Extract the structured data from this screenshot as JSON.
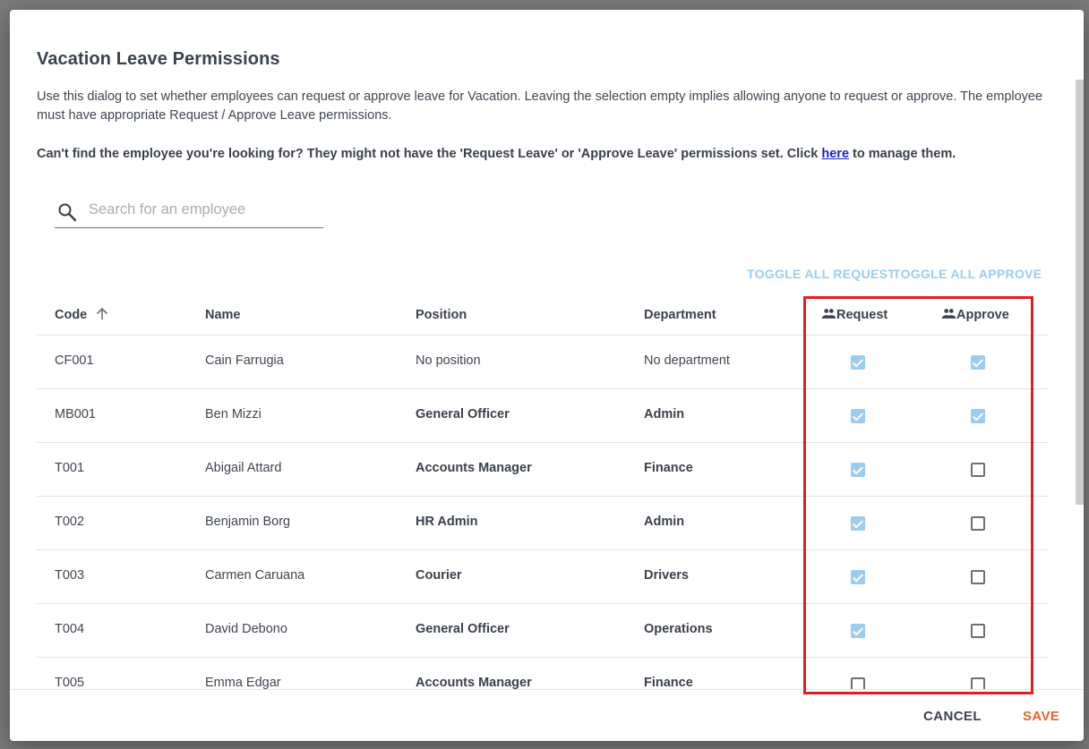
{
  "dialog": {
    "title": "Vacation Leave Permissions",
    "description": "Use this dialog to set whether employees can request or approve leave for Vacation. Leaving the selection empty implies allowing anyone to request or approve. The employee must have appropriate Request / Approve Leave permissions.",
    "note_before": "Can't find the employee you're looking for? They might not have the 'Request Leave' or 'Approve Leave' permissions set. Click ",
    "note_link": "here",
    "note_after": " to manage them."
  },
  "search": {
    "placeholder": "Search for an employee",
    "value": ""
  },
  "actions": {
    "toggle_request": "TOGGLE ALL REQUEST",
    "toggle_approve": "TOGGLE ALL APPROVE"
  },
  "table": {
    "headers": {
      "code": "Code",
      "name": "Name",
      "position": "Position",
      "department": "Department",
      "request": "Request",
      "approve": "Approve"
    },
    "sort": {
      "column": "code",
      "direction": "ascending"
    },
    "rows": [
      {
        "code": "CF001",
        "name": "Cain Farrugia",
        "position": "No position",
        "department": "No department",
        "request": true,
        "approve": true
      },
      {
        "code": "MB001",
        "name": "Ben Mizzi",
        "position": "General Officer",
        "department": "Admin",
        "request": true,
        "approve": true
      },
      {
        "code": "T001",
        "name": "Abigail Attard",
        "position": "Accounts Manager",
        "department": "Finance",
        "request": true,
        "approve": false
      },
      {
        "code": "T002",
        "name": "Benjamin Borg",
        "position": "HR Admin",
        "department": "Admin",
        "request": true,
        "approve": false
      },
      {
        "code": "T003",
        "name": "Carmen Caruana",
        "position": "Courier",
        "department": "Drivers",
        "request": true,
        "approve": false
      },
      {
        "code": "T004",
        "name": "David Debono",
        "position": "General Officer",
        "department": "Operations",
        "request": true,
        "approve": false
      },
      {
        "code": "T005",
        "name": "Emma Edgar",
        "position": "Accounts Manager",
        "department": "Finance",
        "request": false,
        "approve": false
      }
    ]
  },
  "footer": {
    "cancel": "CANCEL",
    "save": "SAVE"
  },
  "colors": {
    "accent": "#9ccdee",
    "save": "#e2642e",
    "highlight": "#e01e26",
    "link": "#1a23cc"
  }
}
